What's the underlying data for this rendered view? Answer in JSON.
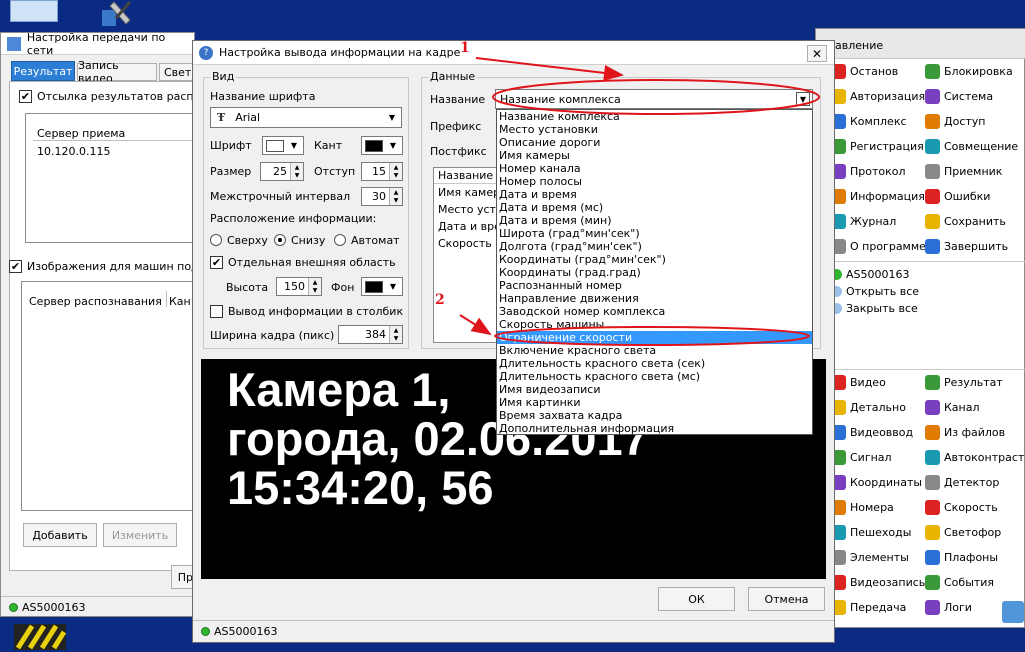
{
  "bg_window": {
    "title": "Настройка передачи по сети",
    "tabs": [
      "Результат",
      "Запись видео",
      "Свет"
    ],
    "send_results_label": "Отсылка результатов распозн",
    "recv_server_header": "Сервер приема",
    "recv_server_value": "10.120.0.115",
    "images_label": "Изображения для машин подтве",
    "table_headers": [
      "Сервер распознавания",
      "Кан"
    ],
    "add_label": "Добавить",
    "edit_label": "Изменить",
    "apply_partial": "Пр",
    "status": "AS5000163"
  },
  "dialog": {
    "title": "Настройка вывода информации на кадре",
    "close_glyph": "✕",
    "view": {
      "group_label": "Вид",
      "font_name_label": "Название шрифта",
      "font_name_value": "Arial",
      "font_label": "Шрифт",
      "edge_label": "Кант",
      "size_label": "Размер",
      "size_value": "25",
      "indent_label": "Отступ",
      "indent_value": "15",
      "line_spacing_label": "Межстрочный интервал",
      "line_spacing_value": "30",
      "location_label": "Расположение информации:",
      "radio_top": "Сверху",
      "radio_bottom": "Снизу",
      "radio_auto": "Автомат",
      "separate_area_label": "Отдельная внешняя область",
      "height_label": "Высота",
      "height_value": "150",
      "bg_label": "Фон",
      "column_label": "Вывод информации в столбик",
      "frame_width_label": "Ширина кадра (пикс)",
      "frame_width_value": "384"
    },
    "data": {
      "group_label": "Данные",
      "name_label": "Название",
      "name_value": "Название комплекса",
      "prefix_label": "Префикс",
      "postfix_label": "Постфикс",
      "list_header": "Название",
      "list_items": [
        "Имя камеры",
        "Место устан",
        "Дата и врем",
        "Скорость ма"
      ]
    },
    "dropdown_items": [
      "Название комплекса",
      "Место установки",
      "Описание дороги",
      "Имя камеры",
      "Номер канала",
      "Номер полосы",
      "Дата и время",
      "Дата и время (мс)",
      "Дата и время (мин)",
      "Широта (град°мин'сек\")",
      "Долгота (град°мин'сек\")",
      "Координаты (град°мин'сек\")",
      "Координаты (град.град)",
      "Распознанный номер",
      "Направление движения",
      "Заводской номер комплекса",
      "Скорость машины",
      "Ограничение скорости",
      "Включение красного света",
      "Длительность красного света (сек)",
      "Длительность красного света (мс)",
      "Имя видеозаписи",
      "Имя картинки",
      "Время захвата кадра",
      "Дополнительная информация"
    ],
    "dropdown_selected_index": 17,
    "preview_lines": [
      "Камера 1,",
      "города, 02.06.2017",
      "15:34:20, 56"
    ],
    "ok_label": "ОК",
    "cancel_label": "Отмена",
    "status": "AS5000163"
  },
  "annotations": {
    "n1": "1",
    "n2": "2",
    "color": "#e0151b"
  },
  "right_panel": {
    "title": "равление",
    "grid1": [
      [
        "Останов",
        "Блокировка"
      ],
      [
        "Авторизация",
        "Система"
      ],
      [
        "Комплекс",
        "Доступ"
      ],
      [
        "Регистрация",
        "Совмещение"
      ],
      [
        "Протокол",
        "Приемник"
      ],
      [
        "Информация",
        "Ошибки"
      ],
      [
        "Журнал",
        "Сохранить"
      ],
      [
        "О программе",
        "Завершить"
      ]
    ],
    "tree": [
      "AS5000163",
      "Открыть все",
      "Закрыть все"
    ],
    "grid2": [
      [
        "Видео",
        "Результат"
      ],
      [
        "Детально",
        "Канал"
      ],
      [
        "Видеоввод",
        "Из файлов"
      ],
      [
        "Сигнал",
        "Автоконтраст"
      ],
      [
        "Координаты",
        "Детектор"
      ],
      [
        "Номера",
        "Скорость"
      ],
      [
        "Пешеходы",
        "Светофор"
      ],
      [
        "Элементы",
        "Плафоны"
      ],
      [
        "Видеозапись",
        "События"
      ],
      [
        "Передача",
        "Логи"
      ]
    ]
  }
}
